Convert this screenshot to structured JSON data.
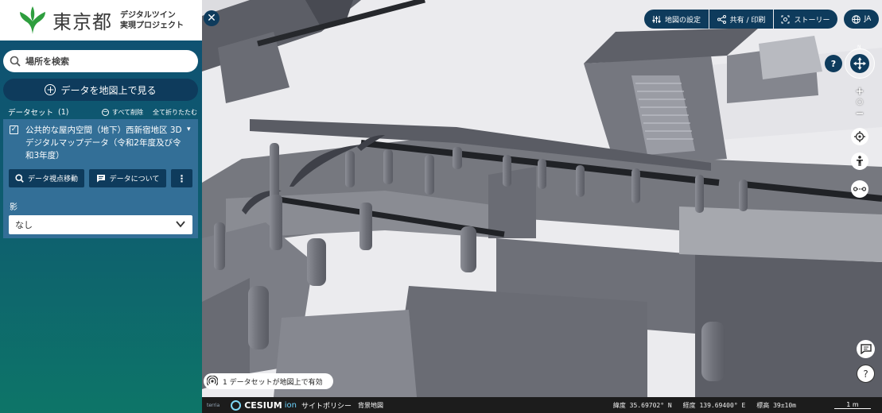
{
  "brand": {
    "name": "東京都",
    "subtitle": "デジタルツイン\n実現プロジェクト"
  },
  "search": {
    "placeholder": "場所を検索",
    "value": ""
  },
  "view_data_button": "データを地図上で見る",
  "dataset_header": {
    "title": "データセット",
    "count": "(1)",
    "remove_all": "すべて削除",
    "collapse_all": "全て折りたたむ"
  },
  "dataset": {
    "checked": true,
    "title": "公共的な屋内空間（地下）西新宿地区 3Dデジタルマップデータ（令和2年度及び令和3年度）",
    "viewpoint_button": "データ視点移動",
    "about_button": "データについて",
    "more_button": "⋮",
    "shadow_label": "影",
    "shadow_value": "なし"
  },
  "toolbar": {
    "map_settings": "地図の設定",
    "share_print": "共有 / 印刷",
    "story": "ストーリー",
    "language": "JA"
  },
  "map_controls": {
    "help": "?",
    "compass_north": "N",
    "zoom_in": "+",
    "zoom_reset": "○",
    "zoom_out": "−",
    "info": "?"
  },
  "active_dataset_pill": "1 データセットが地図上で有効",
  "bottom_bar": {
    "terria": "terria",
    "cesium": "CESIUM",
    "cesium_ion": "ion",
    "site_policy": "サイトポリシー",
    "background_map": "背景地図",
    "latitude": "緯度 35.69702° N",
    "longitude": "経度 139.69400° E",
    "elevation": "標高 39±10m",
    "scale": "1 m"
  },
  "colors": {
    "navy": "#0e3b5c",
    "card": "#336f97",
    "sidebar_top": "#0f4f72",
    "sidebar_bottom": "#0d7568",
    "brand_green": "#2e9e3e"
  }
}
